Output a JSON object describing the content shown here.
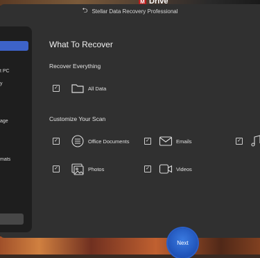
{
  "window": {
    "title": "Stellar Data Recovery Professional"
  },
  "desktop": {
    "drive_label": "Drive",
    "drive_icon_letter": "M"
  },
  "sidebar": {
    "items": [
      {
        "label": "t PC"
      },
      {
        "label": "y"
      },
      {
        "label": "age"
      },
      {
        "label": "mats"
      }
    ]
  },
  "main": {
    "title": "What To Recover",
    "recover_everything": {
      "heading": "Recover Everything",
      "option": {
        "label": "All Data",
        "checked": true,
        "icon": "folder-icon"
      }
    },
    "customize": {
      "heading": "Customize Your Scan",
      "options": [
        {
          "label": "Office Documents",
          "checked": true,
          "icon": "document-icon"
        },
        {
          "label": "Emails",
          "checked": true,
          "icon": "envelope-icon"
        },
        {
          "label": "",
          "checked": true,
          "icon": "music-note-icon"
        },
        {
          "label": "Photos",
          "checked": true,
          "icon": "photos-icon"
        },
        {
          "label": "Videos",
          "checked": true,
          "icon": "video-camera-icon"
        }
      ]
    },
    "next_label": "Next"
  },
  "colors": {
    "accent": "#3d63c9",
    "background": "#303030",
    "panel": "#1e1e1e"
  }
}
